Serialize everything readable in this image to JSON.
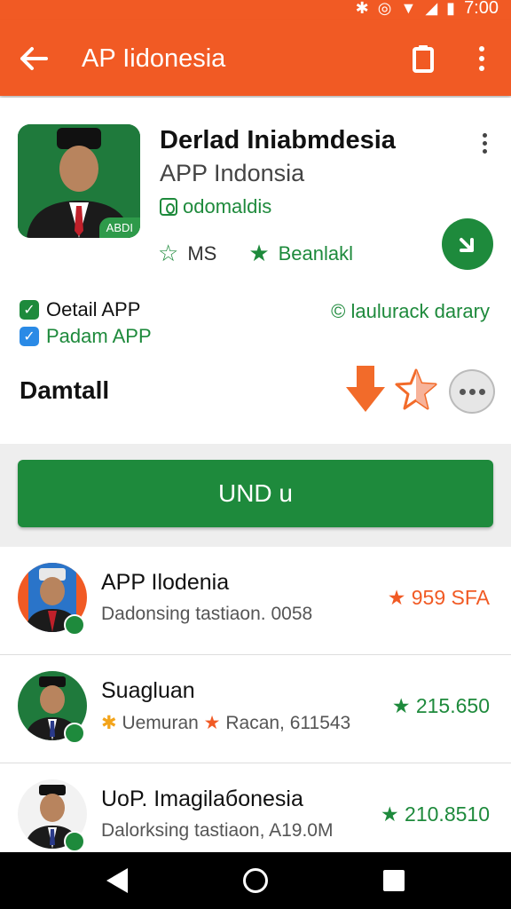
{
  "status_bar": {
    "time": "7:00",
    "icons": [
      "bluetooth-icon",
      "alarm-icon",
      "wifi-icon",
      "signal-icon",
      "battery-icon"
    ]
  },
  "appbar": {
    "title": "AP Iidonesia",
    "icons": [
      "back-arrow-icon",
      "clipboard-icon",
      "more-vert-icon"
    ]
  },
  "app": {
    "title": "Derlad Iniabmdesia",
    "subtitle": "APP Indonsia",
    "developer": "odomaldis",
    "rating_left": "MS",
    "rating_right": "Beanlakl",
    "avatar_badge": "ABDI"
  },
  "checks": [
    {
      "label": "Oetail APP",
      "color": "#1e8a3c"
    },
    {
      "label": "Padam APP",
      "color": "#2a8ae6"
    }
  ],
  "library_link": "© laulurack darary",
  "section_title": "Damtall",
  "install_button": "UND u",
  "list": [
    {
      "title": "APP Ilodenia",
      "subtitle": "Dadonsing tastiaon. 0058",
      "score": "★ 959 SFA",
      "score_color": "orange"
    },
    {
      "title": "Suagluan",
      "subtitle_star1": "✱",
      "subtitle_a": "Uemuran",
      "subtitle_star2": "★",
      "subtitle_b": "Racan, 611543",
      "score": "★ 215.650",
      "score_color": "green"
    },
    {
      "title": "UoP. Imagilaбonesia",
      "subtitle": "Dalorksing tastiaon, A19.0M",
      "score": "★ 210.8510",
      "score_color": "green"
    }
  ],
  "colors": {
    "primary": "#f15a24",
    "green": "#1e8a3c",
    "blue": "#2a8ae6"
  }
}
